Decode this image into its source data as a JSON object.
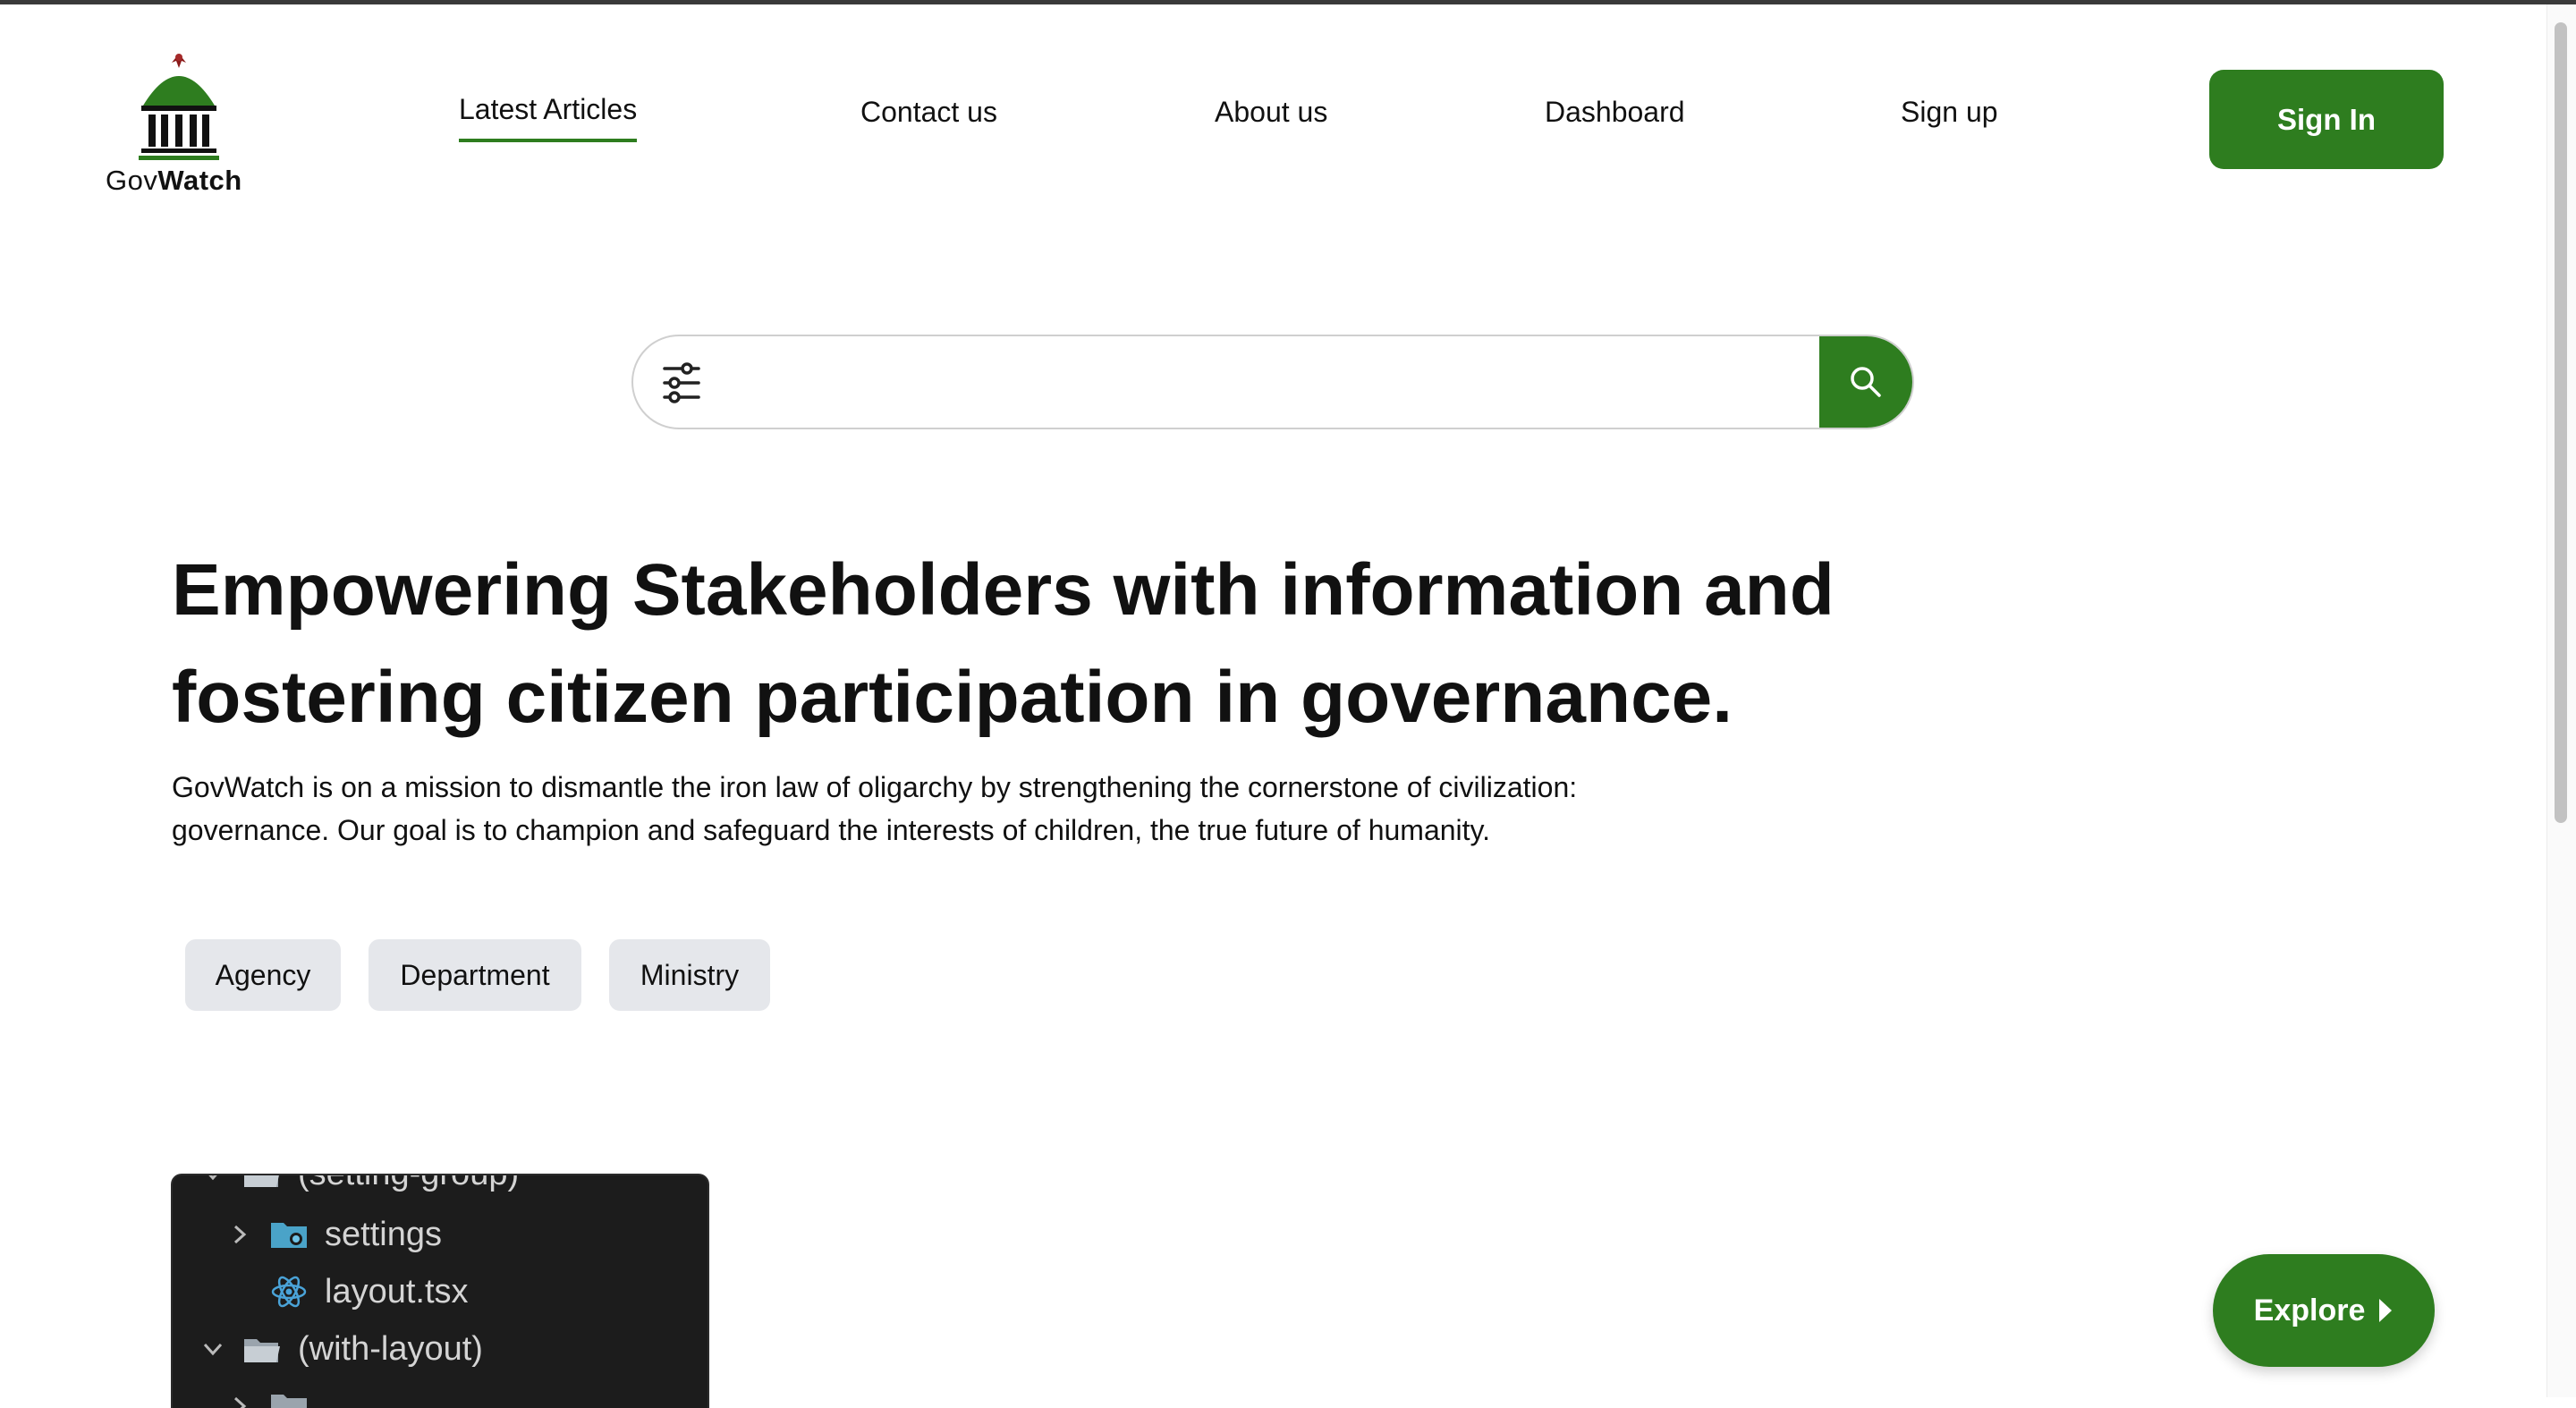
{
  "brand": {
    "prefix": "Gov",
    "suffix": "Watch"
  },
  "nav": {
    "latest_articles": "Latest Articles",
    "contact_us": "Contact us",
    "about_us": "About us",
    "dashboard": "Dashboard",
    "sign_up": "Sign up"
  },
  "signin_label": "Sign In",
  "search": {
    "value": "",
    "placeholder": ""
  },
  "hero": {
    "headline_line1": "Empowering Stakeholders with information and",
    "headline_line2": "fostering citizen participation in governance.",
    "mission_line1": "GovWatch is on a mission to dismantle the iron law of oligarchy by strengthening the cornerstone of civilization:",
    "mission_line2": "governance. Our goal is to champion and safeguard the interests of children, the true future of humanity."
  },
  "chips": [
    "Agency",
    "Department",
    "Ministry"
  ],
  "file_tree": {
    "rows": [
      "(setting-group)",
      "settings",
      "layout.tsx",
      "(with-layout)"
    ]
  },
  "explore_label": "Explore",
  "colors": {
    "accent": "#2e7d1f",
    "chip_bg": "#e5e7eb",
    "tree_bg": "#1c1c1c"
  },
  "icons": {
    "filter": "sliders-icon",
    "search": "magnifier-icon",
    "explore": "caret-right-icon"
  }
}
